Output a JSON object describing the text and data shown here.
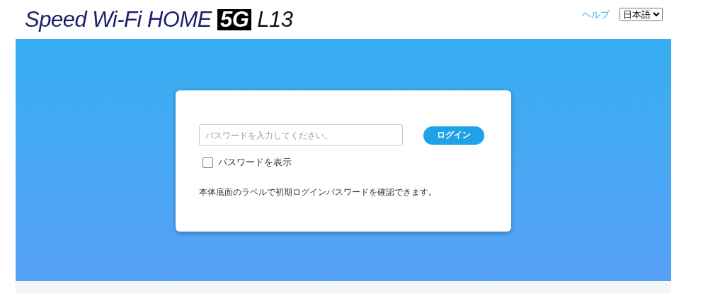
{
  "header": {
    "logo": {
      "name": "Speed Wi-Fi HOME",
      "badge": "5G",
      "model": "L13"
    },
    "help_link": "ヘルプ",
    "language": {
      "value": "日本語"
    }
  },
  "login": {
    "password": {
      "placeholder": "パスワードを入力してください。"
    },
    "login_button": "ログイン",
    "show_password": {
      "label": "パスワードを表示",
      "checked": false
    },
    "note": "本体底面のラベルで初期ログインパスワードを確認できます。"
  }
}
